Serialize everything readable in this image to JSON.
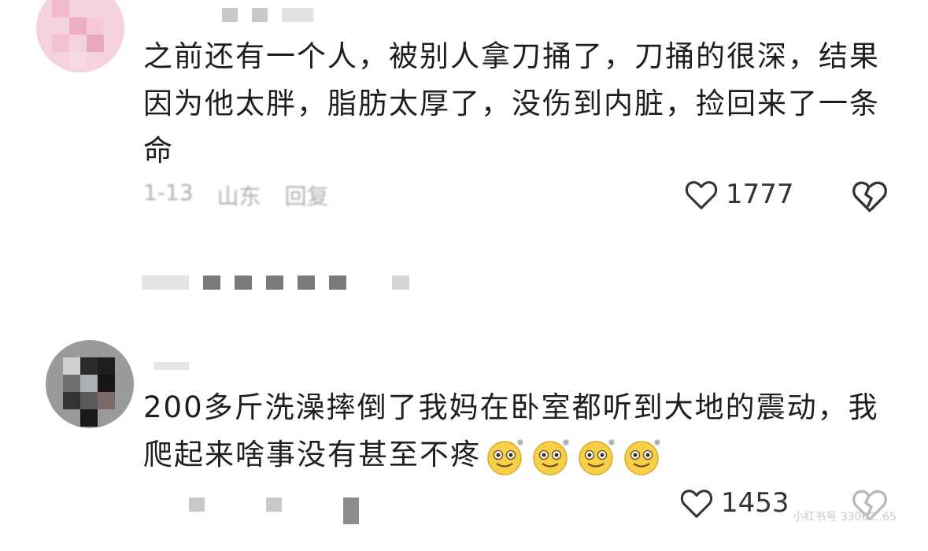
{
  "comments": [
    {
      "text": "之前还有一个人，被别人拿刀捅了，刀捅的很深，结果因为他太胖，脂肪太厚了，没伤到内脏，捡回来了一条命",
      "date": "1-13",
      "location": "山东",
      "reply_label": "回复",
      "likes": "1777"
    },
    {
      "text": "200多斤洗澡摔倒了我妈在卧室都听到大地的震动，我爬起来啥事没有甚至不疼",
      "likes": "1453"
    }
  ],
  "icons": {
    "like": "heart-outline-icon",
    "dislike": "broken-heart-icon",
    "emoji": "dizzy-smile-emoji"
  },
  "watermark": "小红书号 33062..65"
}
